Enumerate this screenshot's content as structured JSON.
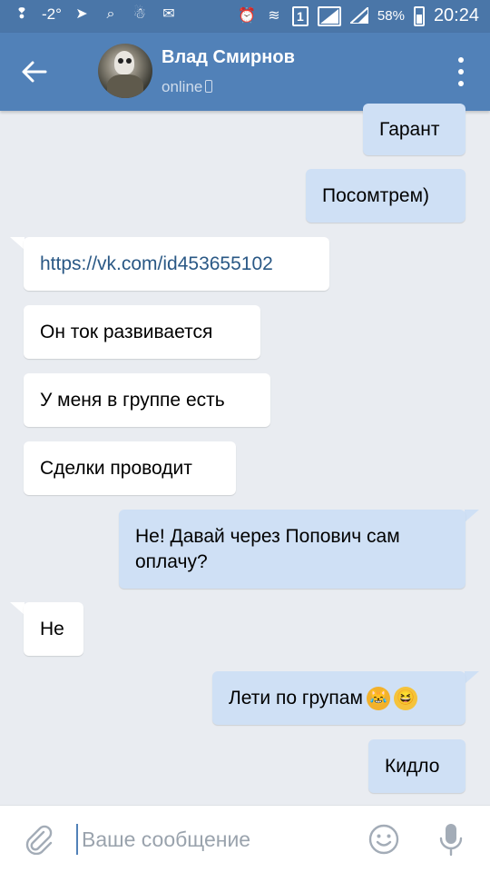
{
  "status_bar": {
    "temperature": "-2°",
    "sim": "1",
    "battery": "58%",
    "time": "20:24"
  },
  "header": {
    "name": "Влад Смирнов",
    "status": "online"
  },
  "messages": [
    {
      "dir": "out",
      "text": "Гарант"
    },
    {
      "dir": "out",
      "text": "Посомтрем)"
    },
    {
      "dir": "in",
      "text": "https://vk.com/id453655102",
      "link": true
    },
    {
      "dir": "in",
      "text": "Он ток развивается"
    },
    {
      "dir": "in",
      "text": "У меня в группе есть"
    },
    {
      "dir": "in",
      "text": "Сделки проводит"
    },
    {
      "dir": "out",
      "text": "Не! Давай через Попович сам оплачу?"
    },
    {
      "dir": "in",
      "text": "Не"
    },
    {
      "dir": "out",
      "text": "Лети по групам",
      "emojis": [
        "crying-laughing-cat-emoji",
        "grinning-squinting-emoji"
      ]
    },
    {
      "dir": "out",
      "text": "Кидло"
    }
  ],
  "input": {
    "placeholder": "Ваше сообщение"
  },
  "icons": {
    "back": "arrow-left-icon",
    "menu": "more-vertical-icon",
    "attach": "paperclip-icon",
    "emoji": "smiley-icon",
    "mic": "microphone-icon"
  },
  "colors": {
    "header": "#5181b8",
    "status_bar": "#4a76a8",
    "background": "#e9ecf1",
    "incoming_bubble": "#ffffff",
    "outgoing_bubble": "#cfe0f5",
    "link": "#2a5885"
  }
}
